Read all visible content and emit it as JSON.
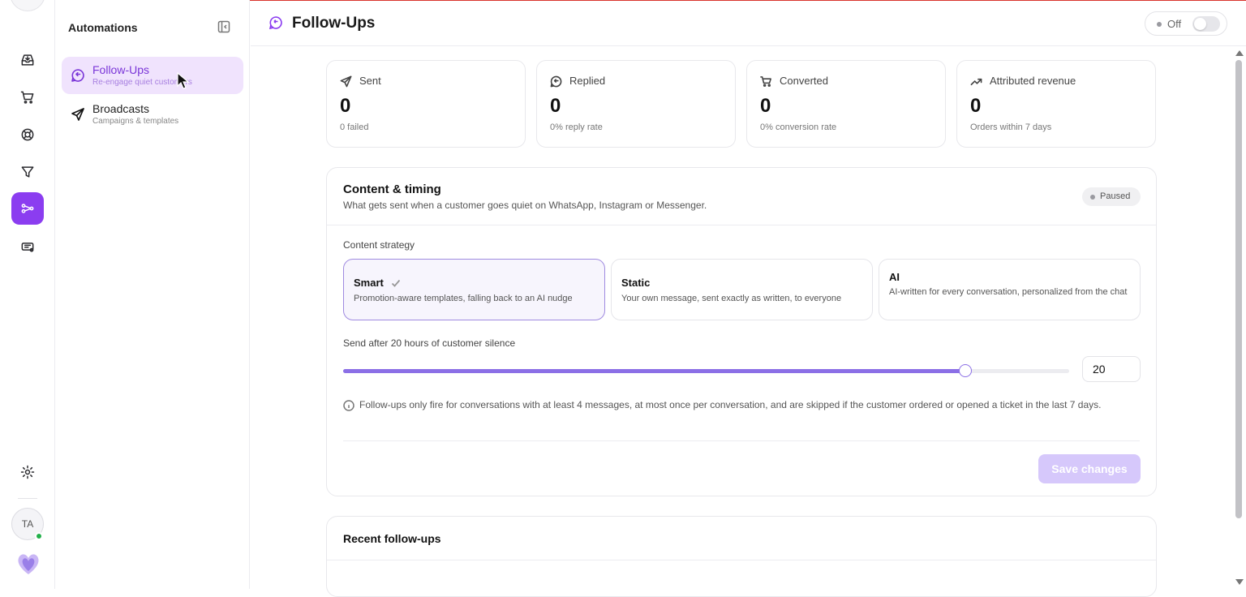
{
  "header": {
    "title": "Follow-Ups",
    "toggle_label": "Off"
  },
  "sidebar": {
    "title": "Automations",
    "items": [
      {
        "label": "Follow-Ups",
        "sub": "Re-engage quiet customers",
        "active": true
      },
      {
        "label": "Broadcasts",
        "sub": "Campaigns & templates",
        "active": false
      }
    ]
  },
  "rail": {
    "icons": [
      "inbox-icon",
      "cart-icon",
      "lifebuoy-icon",
      "filter-icon",
      "automations-icon",
      "tickets-icon"
    ],
    "active": "automations-icon",
    "footer_icons": [
      "settings-icon"
    ],
    "avatar_initials": "TA"
  },
  "stats": [
    {
      "icon": "send-icon",
      "label": "Sent",
      "value": "0",
      "sub": "0 failed"
    },
    {
      "icon": "reply-icon",
      "label": "Replied",
      "value": "0",
      "sub": "0% reply rate"
    },
    {
      "icon": "cart-icon",
      "label": "Converted",
      "value": "0",
      "sub": "0% conversion rate"
    },
    {
      "icon": "trending-up-icon",
      "label": "Attributed revenue",
      "value": "0",
      "sub": "Orders within 7 days"
    }
  ],
  "content": {
    "title": "Content & timing",
    "description": "What gets sent when a customer goes quiet on WhatsApp, Instagram or Messenger.",
    "status_badge": "Paused",
    "strategy_label": "Content strategy",
    "options": [
      {
        "name": "Smart",
        "desc": "Promotion-aware templates, falling back to an AI nudge",
        "selected": true
      },
      {
        "name": "Static",
        "desc": "Your own message, sent exactly as written, to everyone",
        "selected": false
      },
      {
        "name": "AI",
        "desc": "AI-written for every conversation, personalized from the chat",
        "selected": false
      }
    ],
    "delay_label": "Send after 20 hours of customer silence",
    "delay_value": "20",
    "slider_fraction": 0.857,
    "info": "Follow-ups only fire for conversations with at least 4 messages, at most once per conversation, and are skipped if the customer ordered or opened a ticket in the last 7 days.",
    "save_label": "Save changes"
  },
  "recent": {
    "title": "Recent follow-ups"
  },
  "colors": {
    "accent": "#8b3df0",
    "slider": "#8b6fe6",
    "save_disabled": "#d6c8fb",
    "top_line": "#d9342b",
    "online": "#22b04a"
  }
}
